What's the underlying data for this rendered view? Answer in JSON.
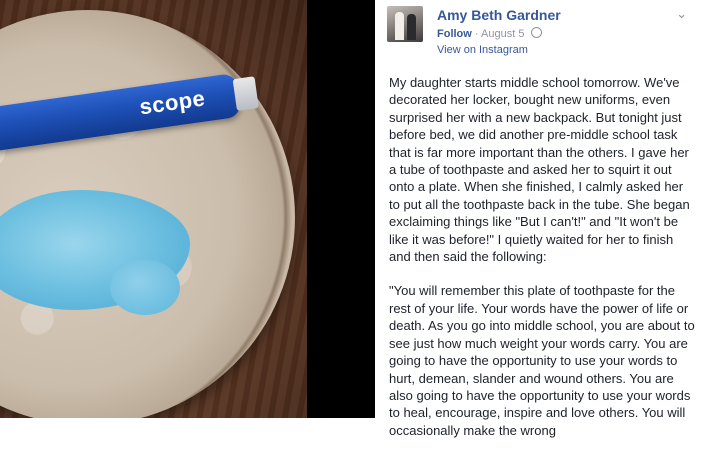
{
  "photo": {
    "tube_brand": "scope"
  },
  "post": {
    "author": "Amy Beth Gardner",
    "follow_label": "Follow",
    "separator": "·",
    "date": "August 5",
    "privacy_icon": "globe-icon",
    "view_link": "View on Instagram",
    "menu_icon": "chevron-down-icon",
    "paragraphs": [
      "My daughter starts middle school tomorrow. We've decorated her locker, bought new uniforms, even surprised her with a new backpack. But tonight just before bed, we did another pre-middle school task that is far more important than the others. I gave her a tube of toothpaste and asked her to squirt it out onto a plate. When she finished, I calmly asked her to put all the toothpaste back in the tube. She began exclaiming things like \"But I can't!\" and \"It won't be like it was before!\" I quietly waited for her to finish and then said the following:",
      "\"You will remember this plate of toothpaste for the rest of your life. Your words have the power of life or death. As you go into middle school, you are about to see just how much weight your words carry. You are going to have the opportunity to use your words to hurt, demean, slander and wound others. You are also going to have the opportunity to use your words to heal, encourage, inspire and love others. You will occasionally make the wrong"
    ]
  },
  "colors": {
    "link": "#365899",
    "meta": "#90949c",
    "text": "#1d2129"
  }
}
